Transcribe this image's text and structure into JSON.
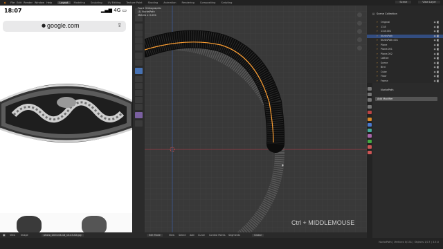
{
  "topbar": {
    "menus": [
      "File",
      "Edit",
      "Render",
      "Window",
      "Help"
    ],
    "workspaces": [
      "Layout",
      "Modeling",
      "Sculpting",
      "UV Editing",
      "Texture Paint",
      "Shading",
      "Animation",
      "Rendering",
      "Compositing",
      "Scripting"
    ],
    "scene": "Scene",
    "view_layer": "View Layer"
  },
  "phone": {
    "time": "18:07",
    "network": "4G",
    "url": "google.com",
    "share_icon": "share-icon",
    "lock_icon": "lock-icon"
  },
  "viewport": {
    "info_lines": [
      "Front Orthographic",
      "(1) NurbsPath",
      "Meters x 0.001"
    ],
    "hint": "Ctrl + MIDDLEMOUSE",
    "mode": "Edit Mode",
    "menus": [
      "View",
      "Select",
      "Add",
      "Curve",
      "Control Points",
      "Segments"
    ],
    "orientation": "Global"
  },
  "image_editor": {
    "menus": [
      "View",
      "Image"
    ],
    "filename": "photo_2023-04-18_13-43-02.jpg"
  },
  "outliner": {
    "title": "Scene Collection",
    "rows": [
      {
        "name": "Original",
        "selected": false
      },
      {
        "name": "13.8",
        "selected": false
      },
      {
        "name": "13.8.001",
        "selected": false
      },
      {
        "name": "NurbsPath",
        "selected": true
      },
      {
        "name": "NurbsPath.001",
        "selected": false
      },
      {
        "name": "Plane",
        "selected": false
      },
      {
        "name": "Plane.001",
        "selected": false
      },
      {
        "name": "Plane.002",
        "selected": false
      },
      {
        "name": "Lattice",
        "selected": false
      },
      {
        "name": "Scene",
        "selected": false
      },
      {
        "name": "Bird",
        "selected": false
      },
      {
        "name": "Cube",
        "selected": false
      },
      {
        "name": "Floor",
        "selected": false
      },
      {
        "name": "Frame",
        "selected": false
      }
    ]
  },
  "properties": {
    "object_name": "NurbsPath",
    "add_modifier": "Add Modifier"
  },
  "status": {
    "right": "NurbsPath | Vertices 0/131 | Objects 1/17 | 3.5.0"
  },
  "colors": {
    "accent": "#4772b3",
    "curve": "#ffa033",
    "axis_x": "#9b3a44",
    "axis_z": "#3d5a96"
  }
}
